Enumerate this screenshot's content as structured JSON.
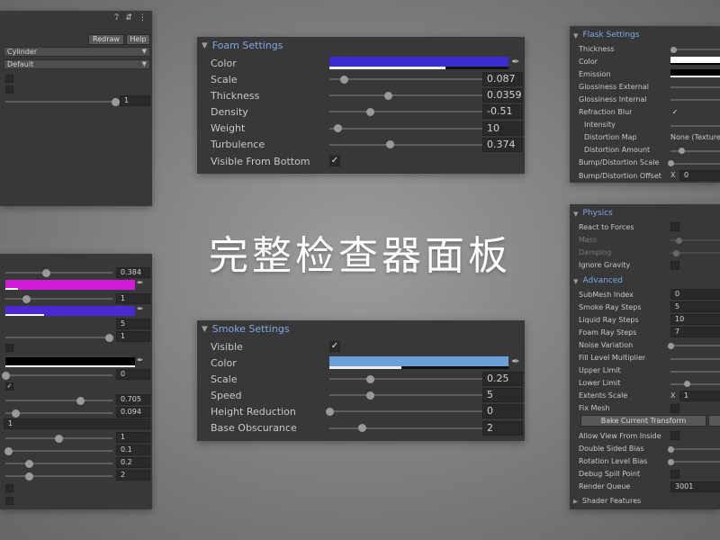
{
  "page_title": "完整检查器面板",
  "colors": {
    "foam_color": "#3a2cd0",
    "smoke_color": "#6aa0d6",
    "magenta": "#d21ad8",
    "violet": "#4b2ad4",
    "black": "#000000",
    "white": "#ffffff"
  },
  "top_left": {
    "icons": [
      "help-icon",
      "settings-icon",
      "more-icon"
    ],
    "redraw_label": "Redraw",
    "help_label": "Help",
    "mesh_dropdown": "Cylinder",
    "preset_dropdown": "Default",
    "slider_value": "1",
    "slider_fraction": 1.0
  },
  "foam": {
    "title": "Foam Settings",
    "color_label": "Color",
    "color_alpha_fraction": 0.65,
    "rows": [
      {
        "label": "Scale",
        "value": "0.087",
        "fraction": 0.09
      },
      {
        "label": "Thickness",
        "value": "0.0359",
        "fraction": 0.36
      },
      {
        "label": "Density",
        "value": "-0.51",
        "fraction": 0.25
      },
      {
        "label": "Weight",
        "value": "10",
        "fraction": 0.05
      },
      {
        "label": "Turbulence",
        "value": "0.374",
        "fraction": 0.37
      }
    ],
    "visible_bottom_label": "Visible From Bottom",
    "visible_bottom_checked": "✓"
  },
  "smoke": {
    "title": "Smoke Settings",
    "visible_label": "Visible",
    "visible_checked": "✓",
    "color_label": "Color",
    "rows": [
      {
        "label": "Scale",
        "value": "0.25",
        "fraction": 0.25
      },
      {
        "label": "Speed",
        "value": "5",
        "fraction": 0.25
      },
      {
        "label": "Height Reduction",
        "value": "0",
        "fraction": 0.0
      },
      {
        "label": "Base Obscurance",
        "value": "2",
        "fraction": 0.2
      }
    ]
  },
  "left_panel": {
    "values": {
      "v1": "0.384",
      "v2": "1",
      "v3": "5",
      "v4": "1",
      "v5": "0",
      "v6": "0.705",
      "v7": "0.094",
      "v8": "1",
      "v9": "1",
      "v10": "0.1",
      "v11": "0.2",
      "v12": "2"
    },
    "checked": "✓"
  },
  "flask": {
    "title": "Flask Settings",
    "rows": [
      {
        "label": "Thickness"
      },
      {
        "label": "Color"
      },
      {
        "label": "Emission"
      },
      {
        "label": "Glossiness External"
      },
      {
        "label": "Glossiness Internal"
      },
      {
        "label": "Refraction Blur",
        "checked": "✓"
      },
      {
        "label": "Intensity"
      },
      {
        "label": "Distortion Map",
        "value": "None (Texture"
      },
      {
        "label": "Distortion Amount"
      },
      {
        "label": "Bump/Distortion Scale"
      },
      {
        "label": "Bump/Distortion Offset",
        "prefix": "X",
        "value": "0"
      }
    ]
  },
  "physics": {
    "title": "Physics",
    "rows": [
      {
        "label": "React to Forces"
      },
      {
        "label": "Mass"
      },
      {
        "label": "Damping"
      },
      {
        "label": "Ignore Gravity"
      }
    ]
  },
  "advanced": {
    "title": "Advanced",
    "rows": [
      {
        "label": "SubMesh Index",
        "value": "0"
      },
      {
        "label": "Smoke Ray Steps",
        "value": "5"
      },
      {
        "label": "Liquid Ray Steps",
        "value": "10"
      },
      {
        "label": "Foam Ray Steps",
        "value": "7"
      },
      {
        "label": "Noise Variation"
      },
      {
        "label": "Fill Level Multiplier"
      },
      {
        "label": "Upper Limit"
      },
      {
        "label": "Lower Limit"
      },
      {
        "label": "Extents Scale",
        "prefix": "X",
        "value": "1"
      },
      {
        "label": "Fix Mesh"
      }
    ],
    "bake_label": "Bake Current Transform",
    "rows2": [
      {
        "label": "Allow View From Inside"
      },
      {
        "label": "Double Sided Bias"
      },
      {
        "label": "Rotation Level Bias"
      },
      {
        "label": "Debug Spill Point"
      },
      {
        "label": "Render Queue",
        "value": "3001"
      }
    ],
    "shader_features_label": "Shader Features"
  }
}
